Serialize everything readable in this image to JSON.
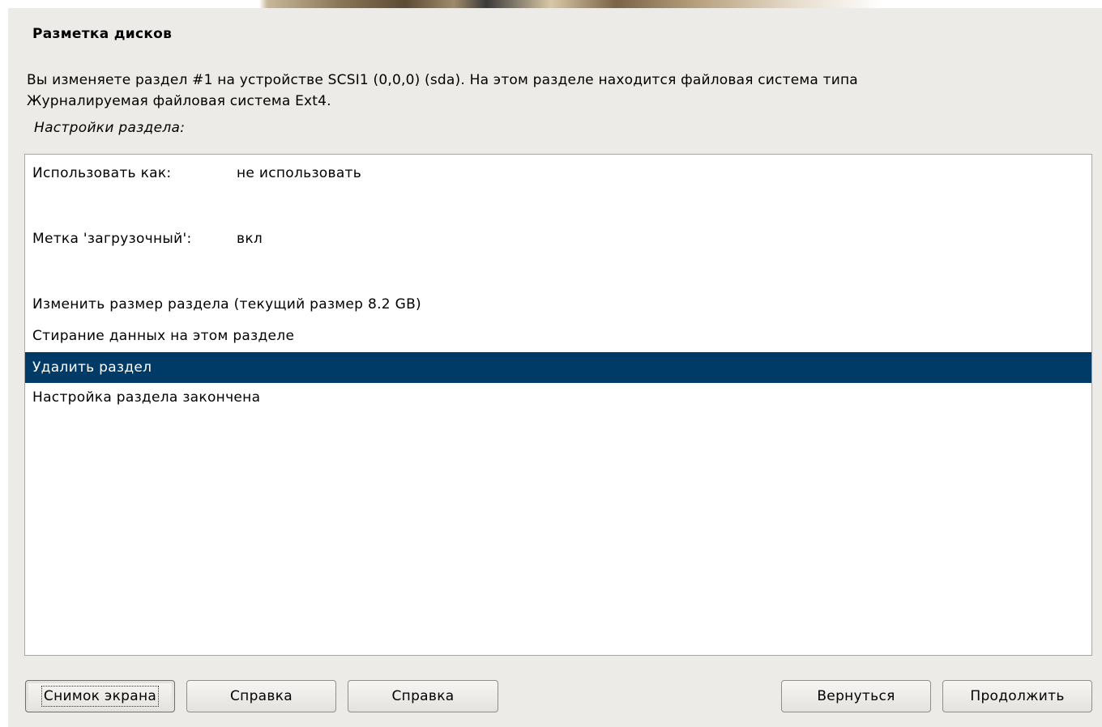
{
  "window": {
    "title": "Разметка дисков"
  },
  "description": {
    "line1": "Вы изменяете раздел #1 на устройстве SCSI1 (0,0,0) (sda). На этом разделе находится файловая система типа",
    "line2": "Журналируемая файловая система Ext4."
  },
  "subheading": "Настройки раздела:",
  "partition_settings": {
    "items": [
      {
        "label": "Использовать как:",
        "value": "не использовать"
      },
      {
        "label": "Метка 'загрузочный':",
        "value": "вкл"
      },
      {
        "label": "Изменить размер раздела (текущий размер 8.2 GB)"
      },
      {
        "label": "Стирание данных на этом разделе"
      },
      {
        "label": "Удалить раздел",
        "selected": true
      },
      {
        "label": "Настройка раздела закончена"
      }
    ],
    "selection_color": "#003a66"
  },
  "buttons": {
    "screenshot": "Снимок экрана",
    "help1": "Справка",
    "help2": "Справка",
    "back": "Вернуться",
    "continue": "Продолжить"
  },
  "colors": {
    "dialog_background": "#ecebe8",
    "list_background": "#ffffff",
    "selected_text": "#ffffff"
  }
}
